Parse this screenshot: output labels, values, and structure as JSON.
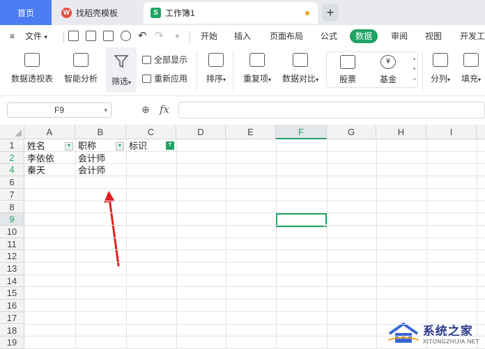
{
  "tabs": {
    "home": "首页",
    "template": "找稻壳模板",
    "workbook": "工作簿1",
    "template_badge": "W",
    "workbook_badge": "S"
  },
  "menu": {
    "file": "文件",
    "items": [
      "开始",
      "插入",
      "页面布局",
      "公式",
      "数据",
      "审阅",
      "视图",
      "开发工"
    ],
    "active": "数据"
  },
  "ribbon": {
    "pivot": "数据透视表",
    "smart_analysis": "智能分析",
    "filter": "筛选",
    "show_all": "全部显示",
    "reapply": "重新应用",
    "sort": "排序",
    "duplicates": "重复项",
    "compare": "数据对比",
    "stock": "股票",
    "fund": "基金",
    "split_column": "分列",
    "fill": "填充",
    "yen_symbol": "¥"
  },
  "formula_bar": {
    "cell_ref": "F9",
    "fx": "fx",
    "value": ""
  },
  "sheet": {
    "columns": [
      "A",
      "B",
      "C",
      "D",
      "E",
      "F",
      "G",
      "H",
      "I"
    ],
    "active_column": "F",
    "rows": [
      "1",
      "2",
      "4",
      "6",
      "7",
      "8",
      "9",
      "10",
      "11",
      "12",
      "13",
      "14",
      "15",
      "16",
      "17",
      "18",
      "19"
    ],
    "active_row": "9",
    "cells": {
      "A1": "姓名",
      "B1": "职称",
      "C1": "标识",
      "A2": "李依依",
      "B2": "会计师",
      "A4": "秦天",
      "B4": "会计师"
    }
  },
  "watermark": {
    "title": "系统之家",
    "subtitle": "XITONGZHIJIA.NET"
  },
  "colors": {
    "accent": "#1fa463",
    "home_tab": "#4c7cf2",
    "arrow": "#e02020"
  }
}
